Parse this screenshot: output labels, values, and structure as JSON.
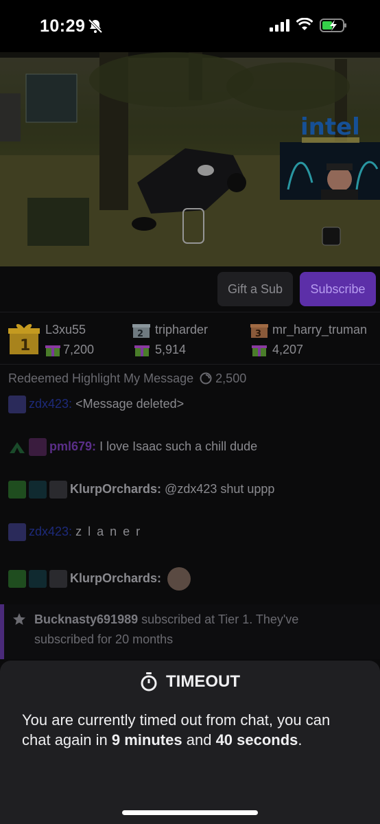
{
  "status_bar": {
    "time": "10:29",
    "icons": [
      "bell-slash-icon",
      "signal-icon",
      "wifi-icon",
      "battery-charging-icon"
    ]
  },
  "video": {
    "description_icons": [
      "stream-video",
      "webcam-overlay",
      "intel-logo"
    ],
    "overlay_text": "intel"
  },
  "actions": {
    "gift_label": "Gift a Sub",
    "subscribe_label": "Subscribe"
  },
  "leaderboard": [
    {
      "rank": "1",
      "name": "L3xu55",
      "amount": "7,200"
    },
    {
      "rank": "2",
      "name": "tripharder",
      "amount": "5,914"
    },
    {
      "rank": "3",
      "name": "mr_harry_truman",
      "amount": "4,207"
    }
  ],
  "chat": {
    "redeem": {
      "text": "Redeemed Highlight My Message",
      "cost": "2,500"
    },
    "messages": [
      {
        "user": "zdx423",
        "text": "<Message deleted>"
      },
      {
        "user": "pml679",
        "text": "I love Isaac such a chill dude"
      },
      {
        "user": "KlurpOrchards",
        "text": "@zdx423 shut uppp"
      },
      {
        "user": "zdx423",
        "text": "z l a n e r"
      },
      {
        "user": "KlurpOrchards",
        "text": ""
      }
    ],
    "sub_notice": {
      "user": "Bucknasty691989",
      "line1": "subscribed at Tier 1. They've",
      "line2": "subscribed for 20 months"
    }
  },
  "timeout": {
    "title": "TIMEOUT",
    "message_pre": "You are currently timed out from chat, you can chat again in",
    "minutes": "9 minutes",
    "and": "and",
    "seconds": "40 seconds",
    "end": "."
  },
  "colors": {
    "accent": "#5c2fa8",
    "sheet_bg": "#1f1f22",
    "panel_bg": "#0b0b0c"
  }
}
